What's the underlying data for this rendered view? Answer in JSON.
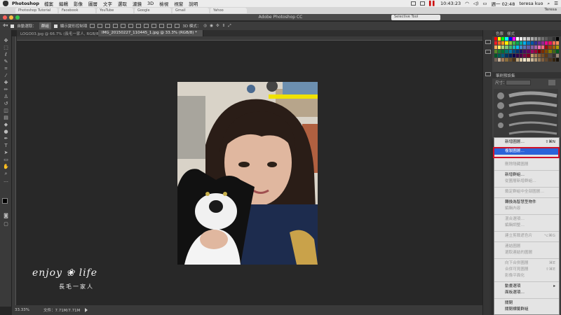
{
  "menubar": {
    "app": "Photoshop",
    "items": [
      "檔案",
      "編輯",
      "影像",
      "圖層",
      "文字",
      "選取",
      "濾鏡",
      "3D",
      "檢視",
      "視窗",
      "說明"
    ],
    "clock": "10:43:23",
    "date": "週一 02:48",
    "user": "teresa kuo"
  },
  "browser": {
    "tabs": [
      "Photoshop Tutorial",
      "Facebook",
      "YouTube",
      "Google",
      "Gmail",
      "Yahoo"
    ],
    "user": "Teresa"
  },
  "window": {
    "title": "Adobe Photoshop CC",
    "floating_tab": "Selective Tool"
  },
  "options": {
    "auto_select_label": "自動選取：",
    "auto_select_value": "群組",
    "transform_label": "顯示變形控制項",
    "mode_3d": "3D 模式："
  },
  "doc_tabs": [
    {
      "label": "LOGO03.jpg @ 66.7% (長毛一家人, RGB/8)"
    },
    {
      "label": "IMG_20150227_110445_1.jpg @ 33.3% (RGB/8) *"
    }
  ],
  "status": {
    "zoom": "33.33%",
    "doc": "文件：7.71M/7.71M"
  },
  "panels": {
    "swatch_tabs": [
      "色票",
      "樣式"
    ],
    "brush_panel": "筆刷預設集",
    "size_label": "尺寸：",
    "swatch_colors": [
      "#ff0000",
      "#ffff00",
      "#00ff00",
      "#00ffff",
      "#0000ff",
      "#ff00ff",
      "#ffffff",
      "#ebebeb",
      "#d6d6d6",
      "#c2c2c2",
      "#adadad",
      "#999999",
      "#858585",
      "#707070",
      "#5c5c5c",
      "#474747",
      "#333333",
      "#000000",
      "#ed1c24",
      "#f26522",
      "#f7941d",
      "#fff200",
      "#8dc63f",
      "#39b54a",
      "#00a651",
      "#00a99d",
      "#00aeef",
      "#0072bc",
      "#0054a6",
      "#2e3192",
      "#662d91",
      "#92278f",
      "#ec008c",
      "#ed145b",
      "#f26c4f",
      "#f68e56",
      "#fbaf5d",
      "#fff568",
      "#acd373",
      "#7cc576",
      "#3cb878",
      "#1cbbb4",
      "#00bff3",
      "#448ccb",
      "#5674b9",
      "#605ca8",
      "#8560a8",
      "#a863a8",
      "#f06eaa",
      "#f26d7d",
      "#9e0b0f",
      "#a0410d",
      "#a36209",
      "#aba000",
      "#598527",
      "#197b30",
      "#007236",
      "#00746b",
      "#0076a3",
      "#004b80",
      "#003471",
      "#1b1464",
      "#440e62",
      "#630460",
      "#9e005d",
      "#9e0039",
      "#790000",
      "#7b2e00",
      "#7d4900",
      "#827b00",
      "#406618",
      "#005e20",
      "#005826",
      "#005952",
      "#005b7f",
      "#003663",
      "#002157",
      "#0d004c",
      "#32004b",
      "#4b0049",
      "#7b0046",
      "#7a0026",
      "#c69c6d",
      "#a67c52",
      "#8c6239",
      "#754c24",
      "#603913",
      "#534741",
      "#362f2d",
      "#998675",
      "#736357",
      "#c7b299",
      "#a17d5c",
      "#8a6d3b",
      "#6b4f2a",
      "#4a3319",
      "#bfa37b",
      "#d9c8a8",
      "#f2e6cc",
      "#e6d5b8",
      "#ccb899",
      "#b39b7a",
      "#997d5c",
      "#806040",
      "#664a2e",
      "#4d361f",
      "#33230f",
      "#1a1208"
    ]
  },
  "context_menu": {
    "items": [
      {
        "label": "新增圖層…",
        "shortcut": "⇧⌘N",
        "state": "enabled"
      },
      {
        "label": "複製圖層…",
        "shortcut": "",
        "state": "selected"
      },
      {
        "label": "刪除隱藏圖層",
        "shortcut": "",
        "state": "disabled"
      },
      {
        "label": "新增群組…",
        "shortcut": "",
        "state": "enabled"
      },
      {
        "label": "從圖層新增群組…",
        "shortcut": "",
        "state": "disabled"
      },
      {
        "label": "鎖定群組中全部圖層…",
        "shortcut": "",
        "state": "disabled"
      },
      {
        "label": "轉換為智慧型物件",
        "shortcut": "",
        "state": "enabled"
      },
      {
        "label": "編輯內容",
        "shortcut": "",
        "state": "disabled"
      },
      {
        "label": "混合選項…",
        "shortcut": "",
        "state": "disabled"
      },
      {
        "label": "編輯調整…",
        "shortcut": "",
        "state": "disabled"
      },
      {
        "label": "建立剪裁遮色片",
        "shortcut": "⌥⌘G",
        "state": "disabled"
      },
      {
        "label": "連結圖層",
        "shortcut": "",
        "state": "disabled"
      },
      {
        "label": "選取連結的圖層",
        "shortcut": "",
        "state": "disabled"
      },
      {
        "label": "向下合併圖層",
        "shortcut": "⌘E",
        "state": "disabled"
      },
      {
        "label": "合併可見圖層",
        "shortcut": "⇧⌘E",
        "state": "disabled"
      },
      {
        "label": "影像平面化",
        "shortcut": "",
        "state": "disabled"
      },
      {
        "label": "動畫選項",
        "shortcut": "▸",
        "state": "enabled"
      },
      {
        "label": "面板選項…",
        "shortcut": "",
        "state": "enabled"
      },
      {
        "label": "關閉",
        "shortcut": "",
        "state": "enabled"
      },
      {
        "label": "關閉標籤群組",
        "shortcut": "",
        "state": "enabled"
      }
    ]
  },
  "watermark": {
    "line1": "enjoy ❀ life",
    "line2": "長毛一家人"
  }
}
